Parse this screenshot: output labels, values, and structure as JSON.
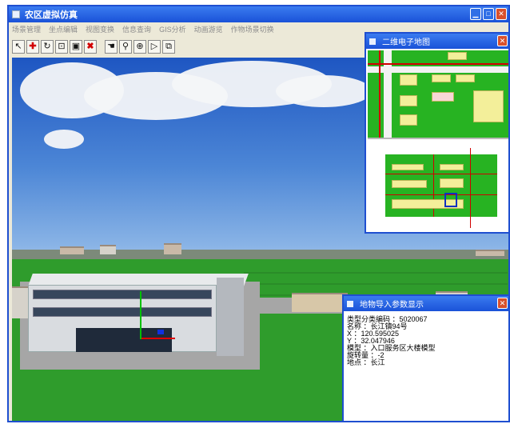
{
  "window": {
    "title": "农区虚拟仿真",
    "controls": [
      "minimize",
      "maximize",
      "close"
    ]
  },
  "menu": {
    "items": [
      "场景管理",
      "坐点编辑",
      "视图变换",
      "信息查询",
      "GIS分析",
      "动画游览",
      "作物场景切换"
    ]
  },
  "toolbar": {
    "tools": [
      {
        "icon": "arrow-cursor-icon",
        "glyph": "↖"
      },
      {
        "icon": "move-cross-icon",
        "glyph": "✚"
      },
      {
        "icon": "rotate-icon",
        "glyph": "↻"
      },
      {
        "icon": "scale-icon",
        "glyph": "⊡"
      },
      {
        "icon": "select-box-icon",
        "glyph": "▣"
      },
      {
        "icon": "delete-x-icon",
        "glyph": "✖"
      },
      {
        "icon": "hand-pan-icon",
        "glyph": "☚"
      },
      {
        "icon": "walk-icon",
        "glyph": "⚲"
      },
      {
        "icon": "zoom-icon",
        "glyph": "⊕"
      },
      {
        "icon": "play-forward-icon",
        "glyph": "▷"
      },
      {
        "icon": "fit-extent-icon",
        "glyph": "⧉"
      }
    ]
  },
  "map_panel": {
    "title": "二维电子地图"
  },
  "info_panel": {
    "title": "地物导入参数显示",
    "lines": [
      "类型分类编码 ：5020067",
      "名称 ：长江镇94号",
      "X ：120.595025",
      "Y ：32.047946",
      "模型 ：入口服务区大楼模型",
      "旋转量 ：-2",
      "地点 ：长江"
    ]
  },
  "colors": {
    "titlebar": "#1a52d8",
    "sky": "#4c86d6",
    "grass": "#2f9c2c",
    "map_green": "#27b322",
    "map_road": "#d00000"
  }
}
